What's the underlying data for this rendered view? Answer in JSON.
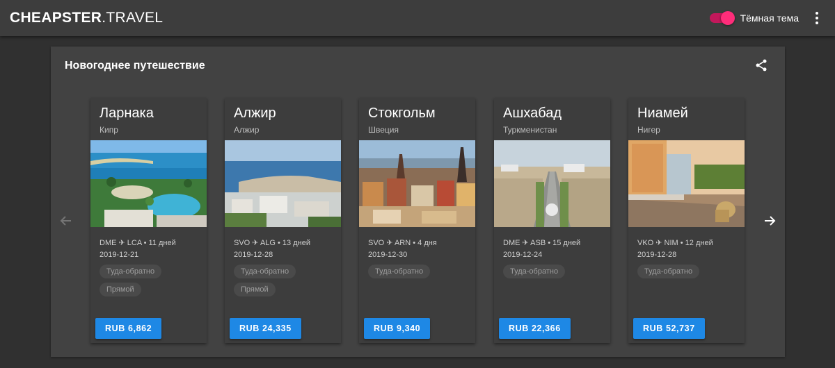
{
  "app": {
    "brand_bold": "CHEAPSTER",
    "brand_thin": ".TRAVEL",
    "theme_toggle_label": "Тёмная тема",
    "theme_toggle_on": true,
    "accent_color": "#ff2d7a",
    "button_color": "#1e88e5",
    "icons": [
      "more-vert-icon",
      "share-icon",
      "chevron-left-icon",
      "arrow-right-icon"
    ]
  },
  "panel": {
    "title": "Новогоднее путешествие"
  },
  "cards": [
    {
      "city": "Ларнака",
      "country": "Кипр",
      "route": "DME ✈ LCA • 11 дней",
      "date": "2019-12-21",
      "tags": [
        "Туда-обратно",
        "Прямой"
      ],
      "price": "RUB 6,862"
    },
    {
      "city": "Алжир",
      "country": "Алжир",
      "route": "SVO ✈ ALG • 13 дней",
      "date": "2019-12-28",
      "tags": [
        "Туда-обратно",
        "Прямой"
      ],
      "price": "RUB 24,335"
    },
    {
      "city": "Стокгольм",
      "country": "Швеция",
      "route": "SVO ✈ ARN • 4 дня",
      "date": "2019-12-30",
      "tags": [
        "Туда-обратно"
      ],
      "price": "RUB 9,340"
    },
    {
      "city": "Ашхабад",
      "country": "Туркменистан",
      "route": "DME ✈ ASB • 15 дней",
      "date": "2019-12-24",
      "tags": [
        "Туда-обратно"
      ],
      "price": "RUB 22,366"
    },
    {
      "city": "Ниамей",
      "country": "Нигер",
      "route": "VKO ✈ NIM • 12 дней",
      "date": "2019-12-28",
      "tags": [
        "Туда-обратно"
      ],
      "price": "RUB 52,737"
    }
  ]
}
